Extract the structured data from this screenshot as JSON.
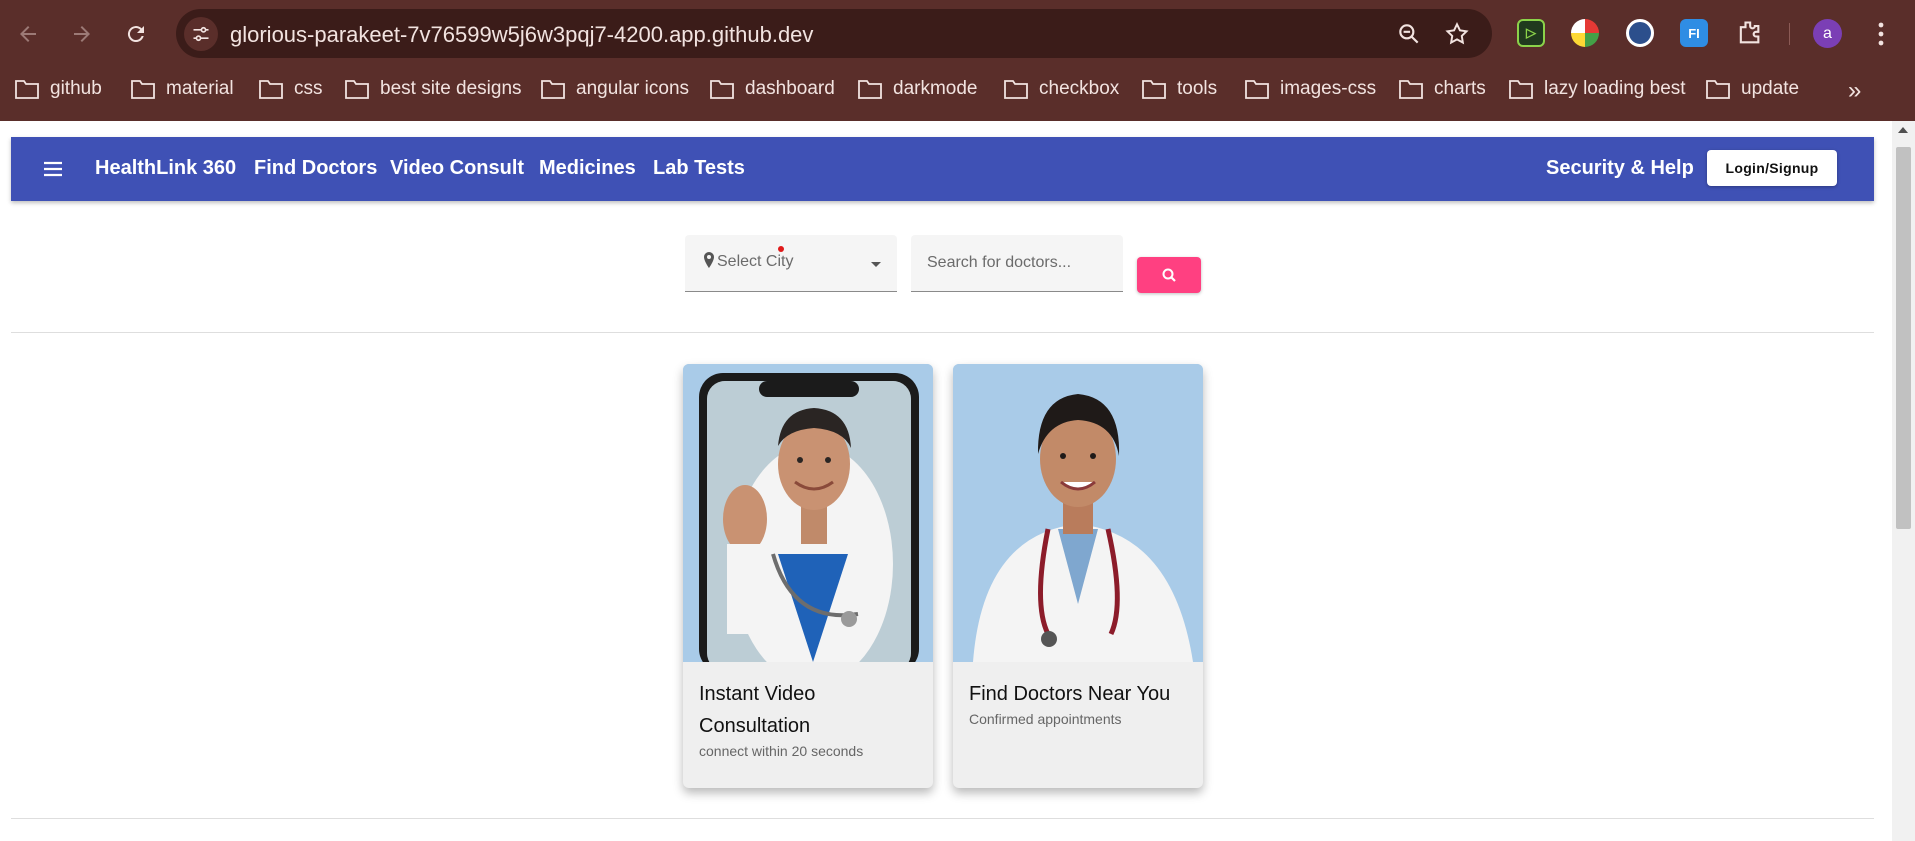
{
  "browser": {
    "url": "glorious-parakeet-7v76599w5j6w3pqj7-4200.app.github.dev",
    "profile_initial": "a",
    "bookmarks": [
      "github",
      "material",
      "css",
      "best site designs",
      "angular icons",
      "dashboard",
      "darkmode",
      "checkbox",
      "tools",
      "images-css",
      "charts",
      "lazy loading best",
      "update"
    ],
    "more_bookmarks_glyph": "»",
    "extensions": [
      {
        "name": "play-extension-icon",
        "label": "▷"
      },
      {
        "name": "colorwheel-extension-icon",
        "label": ""
      },
      {
        "name": "globe-extension-icon",
        "label": ""
      },
      {
        "name": "fi-extension-icon",
        "label": "FI"
      }
    ]
  },
  "app": {
    "brand": "HealthLink 360",
    "nav": [
      "Find Doctors",
      "Video Consult",
      "Medicines",
      "Lab Tests"
    ],
    "security_link": "Security & Help",
    "login_label": "Login/Signup",
    "accent": "#3f51b5",
    "search_accent": "#ff4081"
  },
  "search": {
    "city_placeholder": "Select City",
    "doctor_placeholder": "Search for doctors..."
  },
  "cards": [
    {
      "title": "Instant Video Consultation",
      "subtitle": "connect within 20 seconds"
    },
    {
      "title": "Find Doctors Near You",
      "subtitle": "Confirmed appointments"
    }
  ]
}
